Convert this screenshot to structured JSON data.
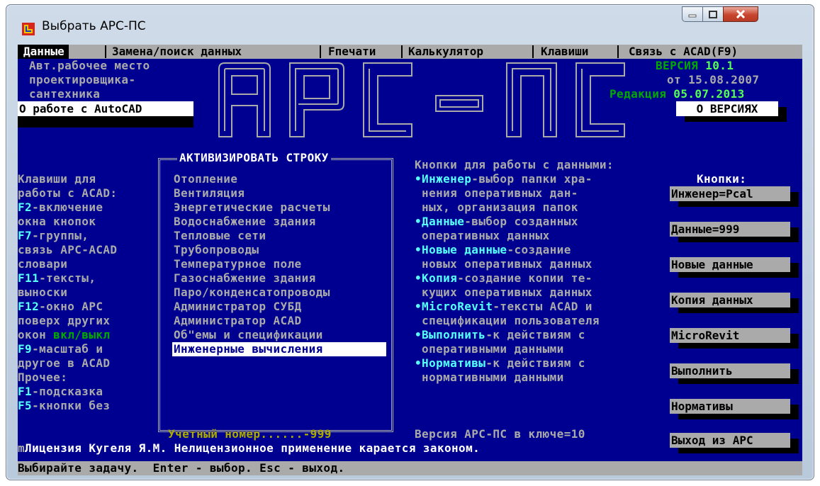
{
  "window": {
    "title": "Выбрать АРС-ПС"
  },
  "menu": [
    "Данные",
    "Замена/поиск данных",
    "Fпечати",
    "Калькулятор",
    "Клавиши",
    "Связь с ACAD(F9)"
  ],
  "header": {
    "left_lines": [
      "Авт.рабочее место",
      "проектировщика-",
      "сантехника"
    ],
    "about_autocad": "О работе с AutoCAD",
    "logo": "АРС — ПС",
    "version_label": "ВЕРСИЯ ",
    "version_number": "10.1",
    "version_date": "от 15.08.2007",
    "edition_label": "Редакция ",
    "edition_date": "05.07.2013",
    "about_versions": "О ВЕРСИЯХ"
  },
  "left_panel": [
    {
      "text": "Клавиши для",
      "color": "gray"
    },
    {
      "text": "работы с ACAD:",
      "color": "gray"
    },
    {
      "key": "F2",
      "text": "-включение"
    },
    {
      "text": "окна кнопок",
      "color": "gray"
    },
    {
      "key": "F7",
      "text": "-группы,"
    },
    {
      "text": "связь АРС-ACAD",
      "color": "gray"
    },
    {
      "text": "словари",
      "color": "gray"
    },
    {
      "key": "F11",
      "text": "-тексты,"
    },
    {
      "text": "выноски",
      "color": "gray"
    },
    {
      "key": "F12",
      "text": "-окно АРС"
    },
    {
      "text": "поверх других",
      "color": "gray"
    },
    {
      "text": "окон ",
      "color": "gray",
      "extra": "вкл/выкл"
    },
    {
      "key": "F9",
      "text": "-масштаб и"
    },
    {
      "text": "другое в ACAD",
      "color": "gray"
    },
    {
      "text": "Прочее:",
      "color": "gray"
    },
    {
      "key": "F1",
      "text": "-подсказка"
    },
    {
      "key": "F5",
      "text": "-кнопки без"
    }
  ],
  "activate": {
    "title": "АКТИВИЗИРОВАТЬ СТРОКУ",
    "items": [
      "Отопление",
      "Вентиляция",
      "Энергетические расчеты",
      "Водоснабжение здания",
      "Тепловые сети",
      "Трубопроводы",
      "Температурное поле",
      "Газоснабжение здания",
      "Паро/конденсатопроводы",
      "Администратор СУБД",
      "Администратор ACAD",
      "Об\"емы и спецификации",
      "Инженерные вычисления"
    ],
    "selected_index": 12
  },
  "info": {
    "heading": "Кнопки для работы с данными:",
    "lines": [
      {
        "bullet": "•",
        "key": "Инженер",
        "text": "-выбор папки хра-"
      },
      {
        "text": " нения оперативных дан-"
      },
      {
        "text": " ных, организация папок"
      },
      {
        "bullet": "•",
        "key": "Данные",
        "text": "-выбор созданных"
      },
      {
        "text": " оперативных данных"
      },
      {
        "bullet": "•",
        "key": "Новые данные",
        "text": "-создание"
      },
      {
        "text": " новых оперативных данных"
      },
      {
        "bullet": "•",
        "key": "Копия",
        "text": "-создание копии те-"
      },
      {
        "text": " кущих оперативных данных"
      },
      {
        "bullet": "•",
        "key": "MicroRevit",
        "text": "-тексты ACAD и"
      },
      {
        "text": " спецификации пользователя"
      },
      {
        "bullet": "•",
        "key": "Выполнить",
        "text": "-к действиям с"
      },
      {
        "text": " оперативными данными"
      },
      {
        "bullet": "•",
        "key": "Нормативы",
        "text": "-к действиям с"
      },
      {
        "text": " нормативными данными"
      }
    ]
  },
  "buttons": {
    "heading": "Кнопки:",
    "items": [
      "Инженер=Pcal",
      "Данные=999",
      "Новые данные",
      "Копия данных",
      "MicroRevit",
      "Выполнить",
      "Нормативы",
      "Выход из АРС"
    ]
  },
  "bottom": {
    "account": "Учетный номер......-999",
    "key_version": "Версия АРС-ПС в ключе=10",
    "license_prefix": "m",
    "license": "Лицензия Кугеля Я.М. Нелицензионное применение карается законом."
  },
  "status": "Выбирайте задачу.  Enter - выбор. Esc - выход.",
  "colors": {
    "background": "#000090",
    "text_gray": "#aaaaaa",
    "key_cyan": "#55ffff",
    "version_green": "#00aa00",
    "highlight_green": "#55ff55"
  }
}
